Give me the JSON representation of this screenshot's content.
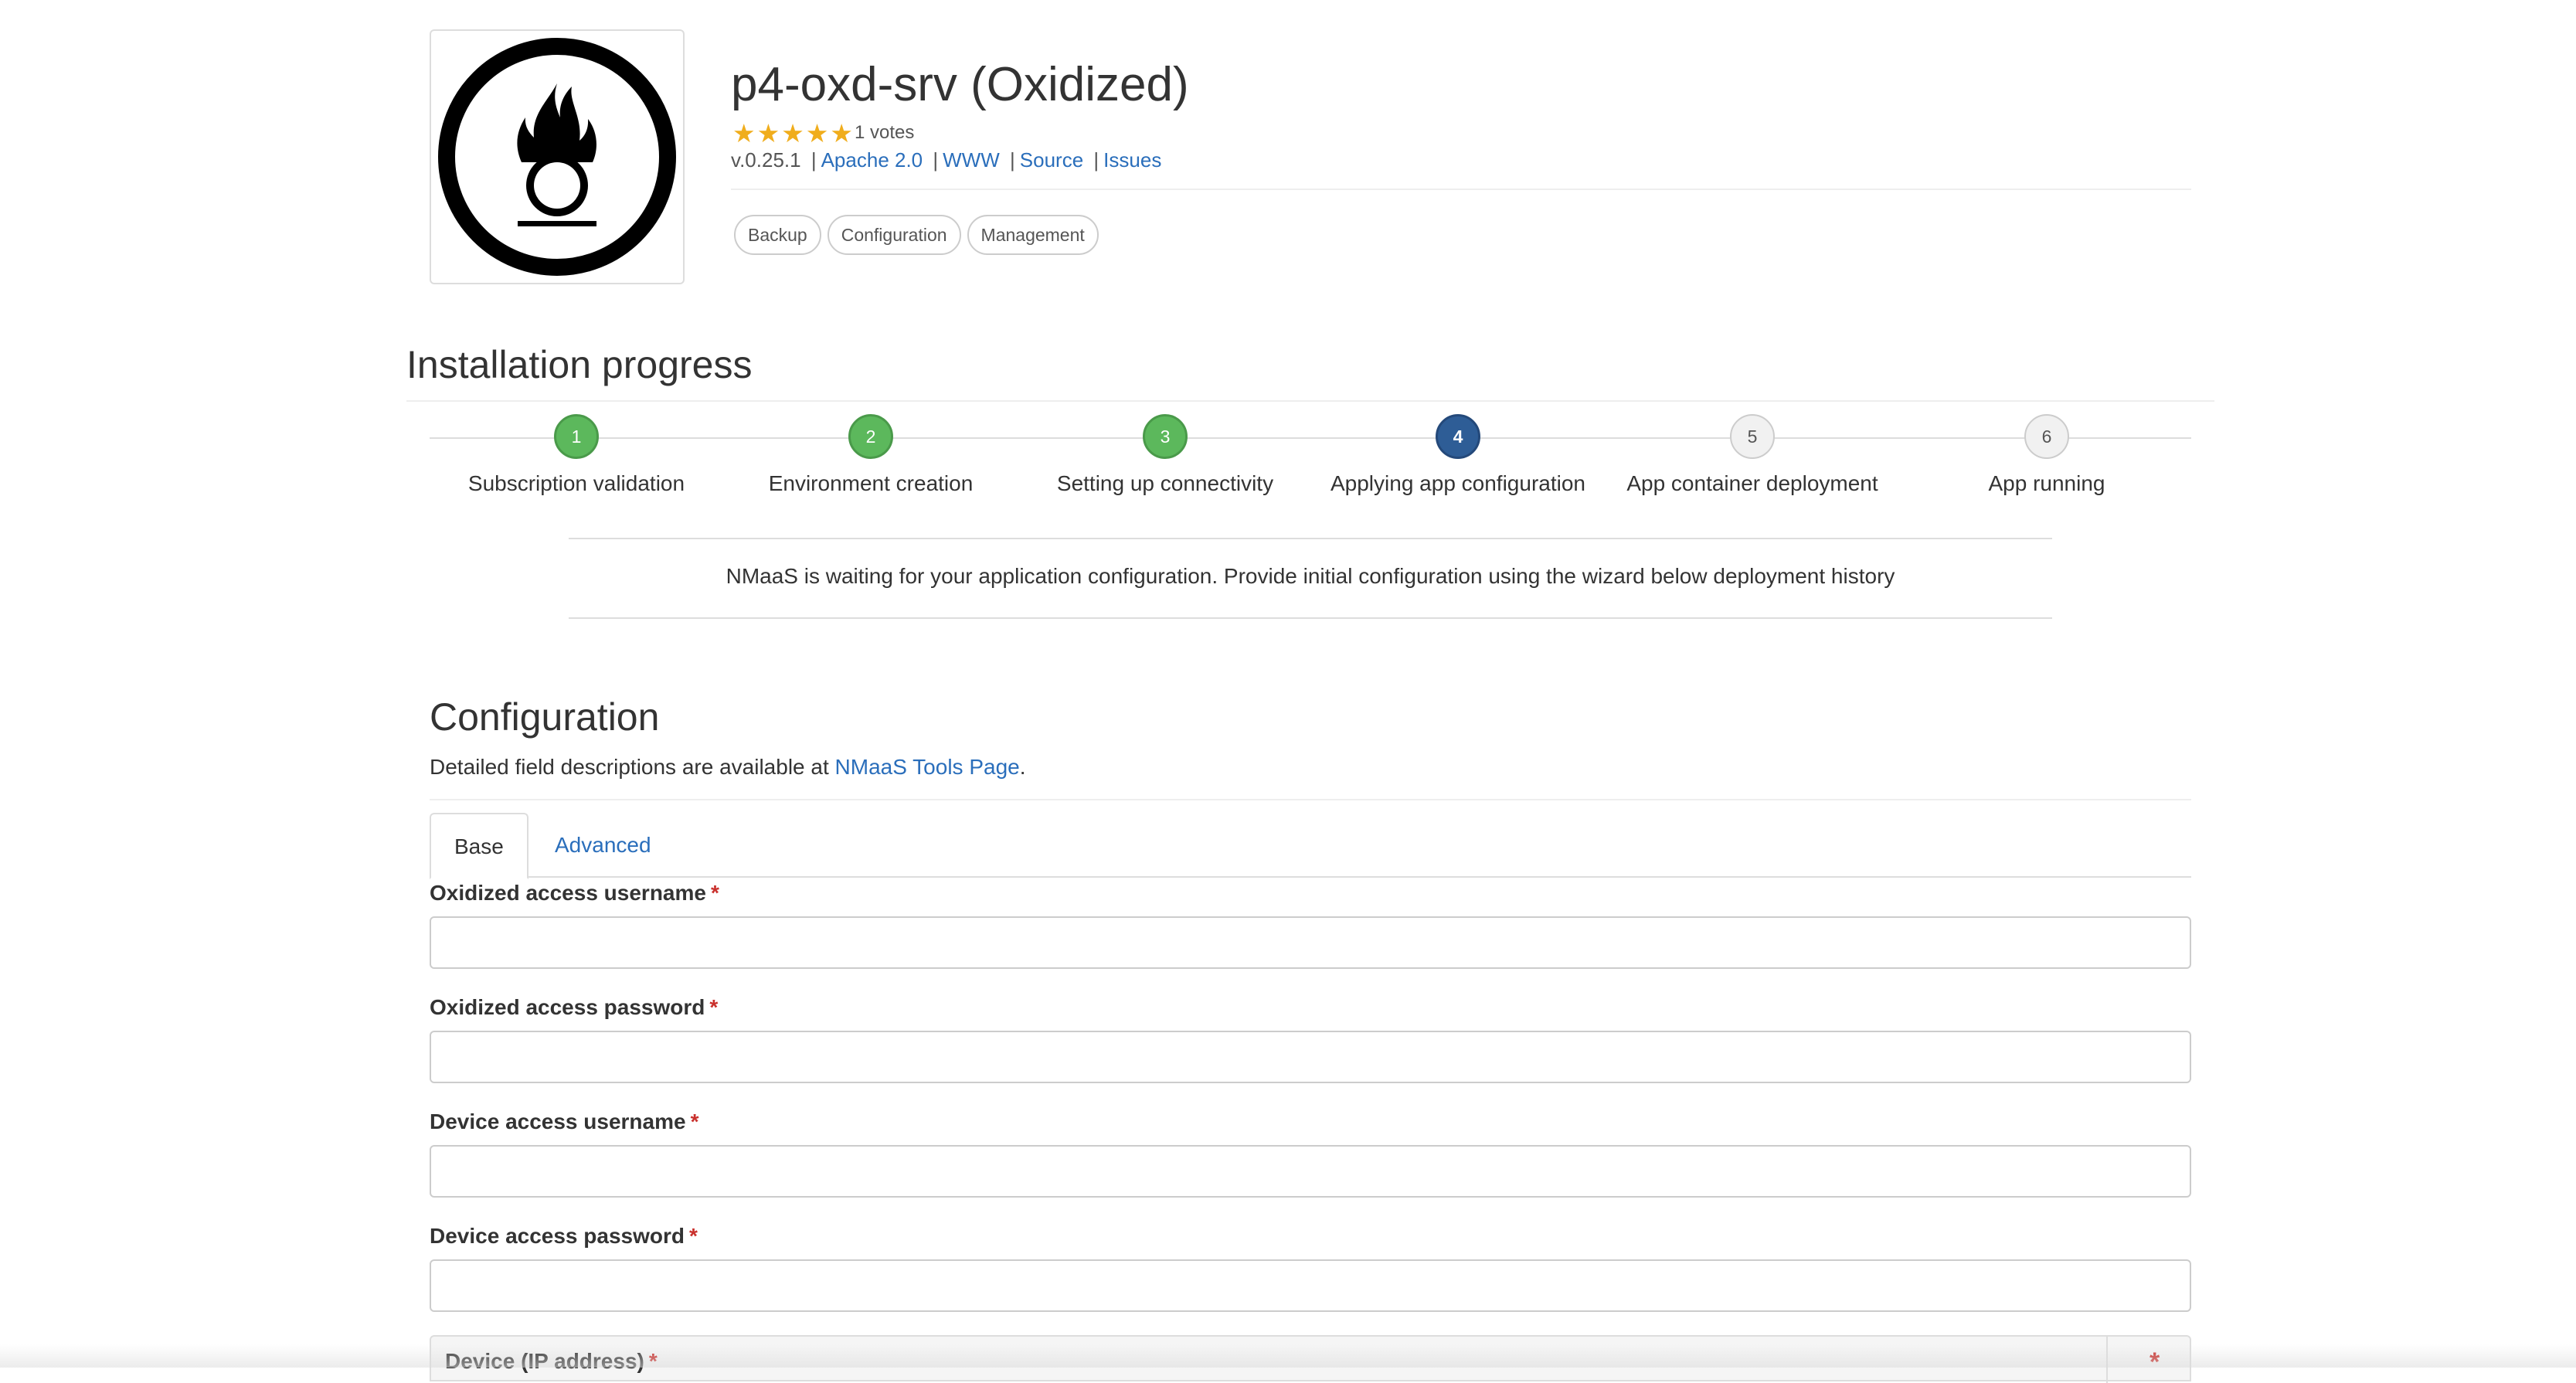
{
  "app": {
    "logo_icon": "oxidizer-hazard-icon",
    "title": "p4-oxd-srv (Oxidized)",
    "rating": {
      "stars": 5,
      "max_stars": 5,
      "votes_text": "1 votes",
      "star_color": "#f0ad1c"
    },
    "version": "v.0.25.1",
    "links": {
      "license": "Apache 2.0",
      "www": "WWW",
      "source": "Source",
      "issues": "Issues"
    },
    "tags": [
      "Backup",
      "Configuration",
      "Management"
    ]
  },
  "progress": {
    "title": "Installation progress",
    "steps": [
      {
        "number": "1",
        "label": "Subscription validation",
        "status": "done"
      },
      {
        "number": "2",
        "label": "Environment creation",
        "status": "done"
      },
      {
        "number": "3",
        "label": "Setting up connectivity",
        "status": "done"
      },
      {
        "number": "4",
        "label": "Applying app configuration",
        "status": "active"
      },
      {
        "number": "5",
        "label": "App container deployment",
        "status": "pending"
      },
      {
        "number": "6",
        "label": "App running",
        "status": "pending"
      }
    ],
    "colors": {
      "done": "#5cb85c",
      "active": "#2e5d96",
      "pending": "#f1f1f1"
    },
    "notice": "NMaaS is waiting for your application configuration. Provide initial configuration using the wizard below deployment history"
  },
  "configuration": {
    "title": "Configuration",
    "description_prefix": "Detailed field descriptions are available at ",
    "description_link": "NMaaS Tools Page",
    "description_suffix": ".",
    "tabs": [
      {
        "label": "Base",
        "active": true
      },
      {
        "label": "Advanced",
        "active": false
      }
    ],
    "fields": [
      {
        "label": "Oxidized access username",
        "required_mark": "*",
        "value": ""
      },
      {
        "label": "Oxidized access password",
        "required_mark": "*",
        "value": ""
      },
      {
        "label": "Device access username",
        "required_mark": "*",
        "value": ""
      },
      {
        "label": "Device access password",
        "required_mark": "*",
        "value": ""
      }
    ],
    "device_panel": {
      "label": "Device (IP address)",
      "required_mark": "*"
    }
  }
}
